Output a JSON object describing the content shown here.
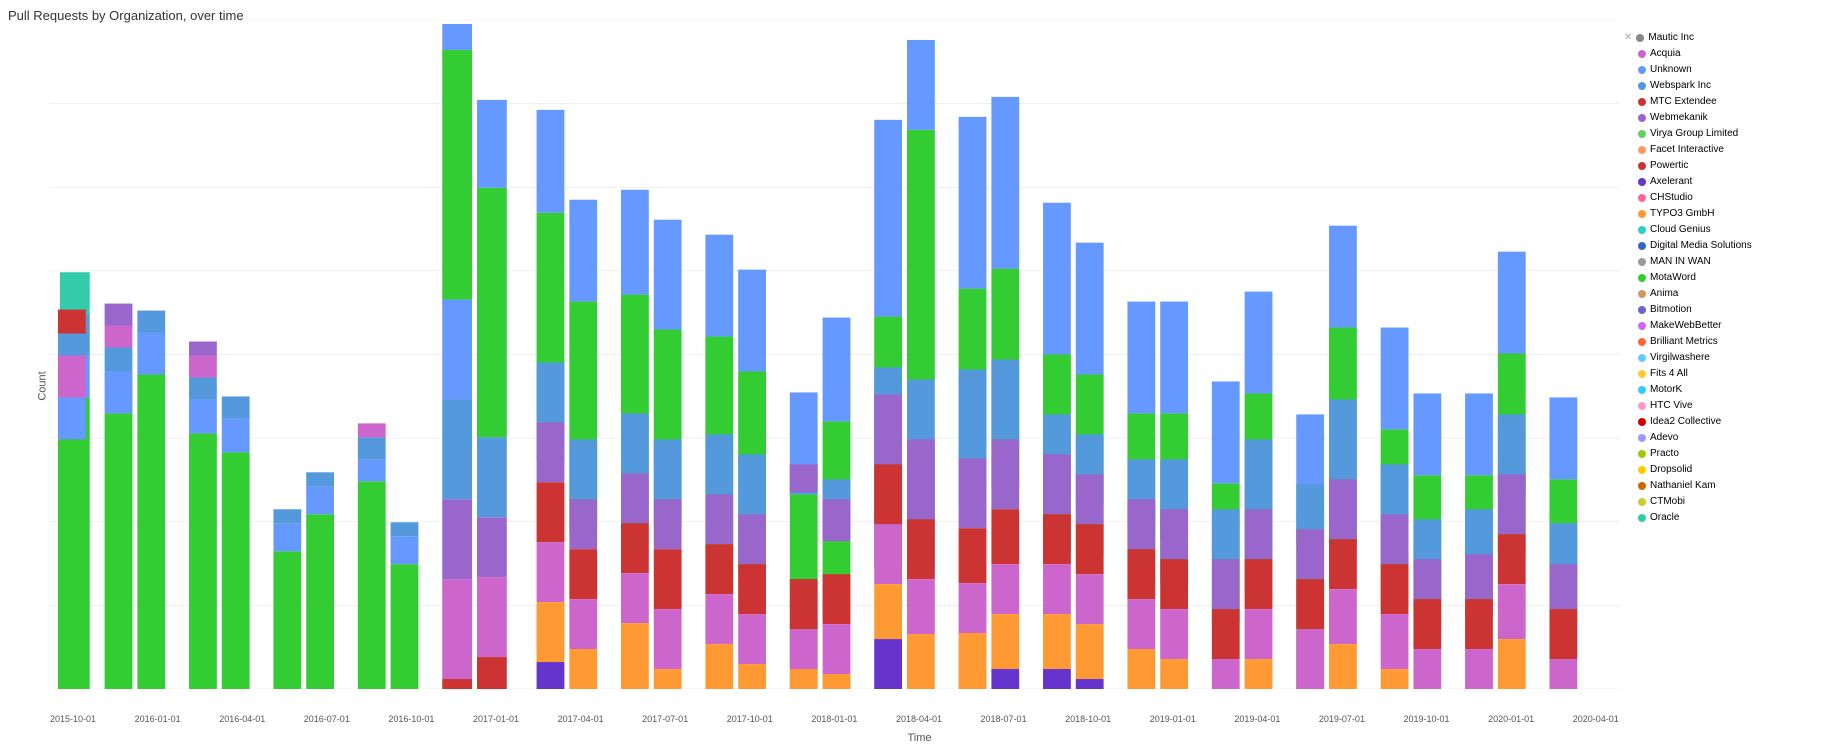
{
  "title": "Pull Requests by Organization, over time",
  "yAxisLabel": "Count",
  "xAxisLabel": "Time",
  "yMax": 160,
  "yTicks": [
    0,
    20,
    40,
    60,
    80,
    100,
    120,
    140,
    160
  ],
  "xLabels": [
    "2015-10-01",
    "2016-01-01",
    "2016-04-01",
    "2016-07-01",
    "2016-10-01",
    "2017-01-01",
    "2017-04-01",
    "2017-07-01",
    "2017-10-01",
    "2018-01-01",
    "2018-04-01",
    "2018-07-01",
    "2018-10-01",
    "2019-01-01",
    "2019-04-01",
    "2019-07-01",
    "2019-10-01",
    "2020-01-01",
    "2020-04-01"
  ],
  "legend": [
    {
      "label": "Mautic Inc",
      "color": "#888888"
    },
    {
      "label": "Acquia",
      "color": "#cc66cc"
    },
    {
      "label": "Unknown",
      "color": "#6699ff"
    },
    {
      "label": "Webspark Inc",
      "color": "#5599dd"
    },
    {
      "label": "MTC Extendee",
      "color": "#cc3333"
    },
    {
      "label": "Webmekanik",
      "color": "#9966cc"
    },
    {
      "label": "Virya Group Limited",
      "color": "#66cc66"
    },
    {
      "label": "Facet Interactive",
      "color": "#ff9966"
    },
    {
      "label": "Powertic",
      "color": "#cc3333"
    },
    {
      "label": "Axelerant",
      "color": "#6633cc"
    },
    {
      "label": "CHStudio",
      "color": "#ff6699"
    },
    {
      "label": "TYPO3 GmbH",
      "color": "#ff9933"
    },
    {
      "label": "Cloud Genius",
      "color": "#33cccc"
    },
    {
      "label": "Digital Media Solutions",
      "color": "#3366cc"
    },
    {
      "label": "MAN IN WAN",
      "color": "#999999"
    },
    {
      "label": "MotaWord",
      "color": "#33cc33"
    },
    {
      "label": "Anima",
      "color": "#cc9966"
    },
    {
      "label": "Bitmotion",
      "color": "#6666cc"
    },
    {
      "label": "MakeWebBetter",
      "color": "#cc66ff"
    },
    {
      "label": "Brilliant Metrics",
      "color": "#ff6633"
    },
    {
      "label": "Virgilwashere",
      "color": "#66ccff"
    },
    {
      "label": "Fits 4 All",
      "color": "#ffcc33"
    },
    {
      "label": "MotorK",
      "color": "#33ccff"
    },
    {
      "label": "HTC Vive",
      "color": "#ff99cc"
    },
    {
      "label": "Idea2 Collective",
      "color": "#cc0000"
    },
    {
      "label": "Adevo",
      "color": "#9999ff"
    },
    {
      "label": "Practo",
      "color": "#99cc00"
    },
    {
      "label": "Dropsolid",
      "color": "#ffcc00"
    },
    {
      "label": "Nathaniel Kam",
      "color": "#cc6600"
    },
    {
      "label": "CTMobi",
      "color": "#cccc33"
    },
    {
      "label": "Oracle",
      "color": "#33ccaa"
    }
  ]
}
